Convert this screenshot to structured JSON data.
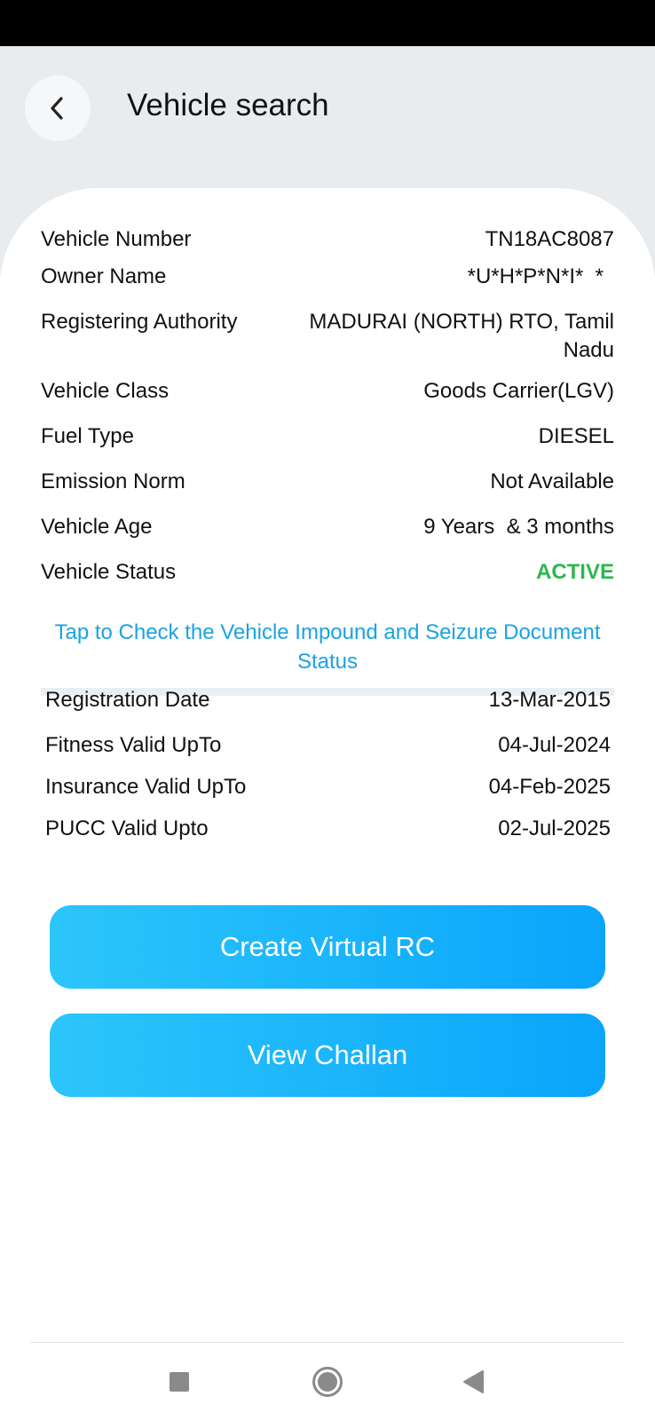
{
  "header": {
    "title": "Vehicle search"
  },
  "details": [
    {
      "label": "Vehicle Number",
      "value": "TN18AC8087"
    },
    {
      "label": "Owner Name",
      "value": "*U*H*P*N*I*  *"
    },
    {
      "label": "Registering Authority",
      "value": "MADURAI (NORTH) RTO, Tamil Nadu"
    },
    {
      "label": "Vehicle Class",
      "value": "Goods Carrier(LGV)"
    },
    {
      "label": "Fuel Type",
      "value": "DIESEL"
    },
    {
      "label": "Emission Norm",
      "value": "Not Available"
    },
    {
      "label": "Vehicle Age",
      "value": "9 Years  & 3 months"
    },
    {
      "label": "Vehicle Status",
      "value": "ACTIVE"
    }
  ],
  "impound_link": "Tap to Check the Vehicle Impound and Seizure Document Status",
  "validity": [
    {
      "label": "Registration Date",
      "value": "13-Mar-2015"
    },
    {
      "label": "Fitness Valid UpTo",
      "value": "04-Jul-2024"
    },
    {
      "label": "Insurance Valid UpTo",
      "value": "04-Feb-2025"
    },
    {
      "label": "PUCC Valid Upto",
      "value": "02-Jul-2025"
    }
  ],
  "buttons": {
    "create_virtual_rc": "Create Virtual RC",
    "view_challan": "View Challan"
  },
  "colors": {
    "status_active": "#2db84d",
    "link": "#1aa3e0",
    "button_gradient_start": "#2cc6fb",
    "button_gradient_end": "#0aa5fb",
    "header_bg": "#e9ecef"
  },
  "icons": {
    "back": "chevron-left-icon",
    "nav_recents": "square-icon",
    "nav_home": "circle-icon",
    "nav_back": "triangle-left-icon"
  }
}
